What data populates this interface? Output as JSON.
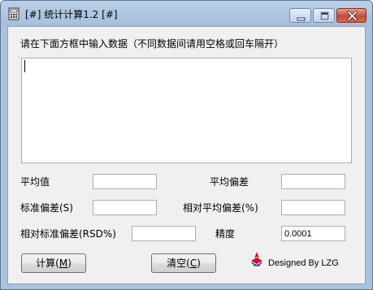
{
  "window": {
    "title": "[#] 统计计算1.2 [#]",
    "icon": "calculator-app-icon"
  },
  "controls": {
    "minimize": "minimize-icon",
    "maximize": "maximize-icon",
    "close": "close-icon"
  },
  "instructions": "请在下面方框中输入数据（不同数据间请用空格或回车隔开）",
  "input": {
    "value": ""
  },
  "results": {
    "mean_label": "平均值",
    "mean_value": "",
    "avg_dev_label": "平均偏差",
    "avg_dev_value": "",
    "std_dev_label": "标准偏差(S)",
    "std_dev_value": "",
    "rel_avg_dev_label": "相对平均偏差(%)",
    "rel_avg_dev_value": "",
    "rsd_label": "相对标准偏差(RSD%)",
    "rsd_value": "",
    "precision_label": "精度",
    "precision_value": "0.0001"
  },
  "buttons": {
    "calculate_label": "计算",
    "calculate_key": "M",
    "clear_label": "清空",
    "clear_key": "C"
  },
  "credit": "Designed By LZG",
  "colors": {
    "window_frame": "#a9c3df",
    "client_bg": "#f0f0f0",
    "close_button": "#c64b34",
    "logo_red": "#d0102a",
    "logo_blue": "#2a3f9a"
  }
}
